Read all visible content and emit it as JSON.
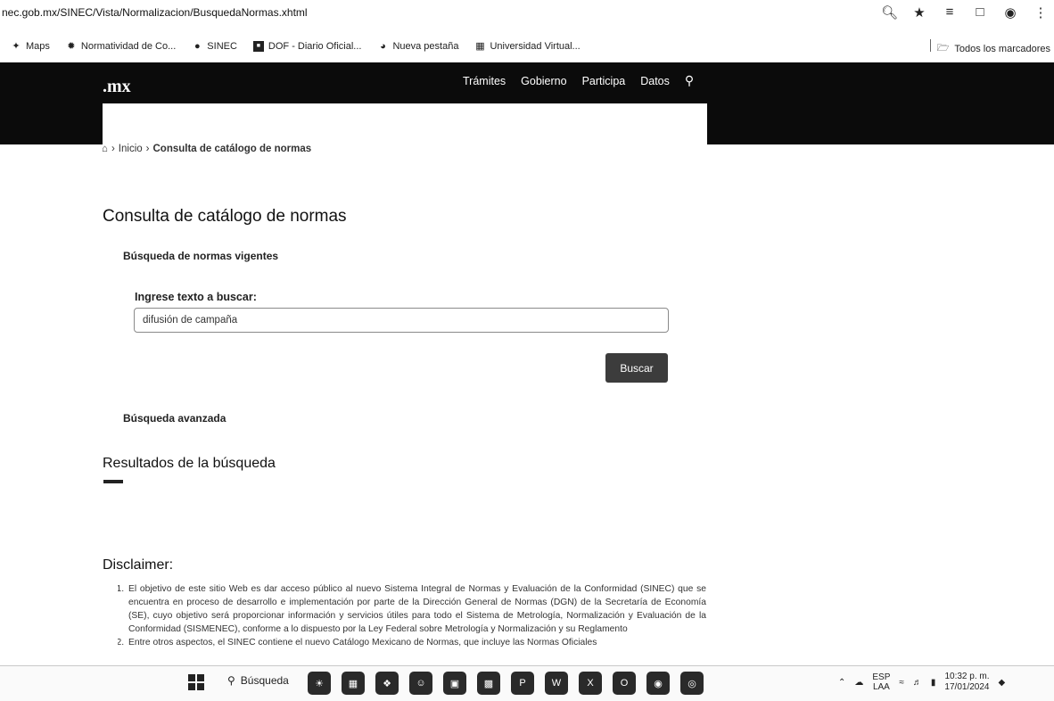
{
  "browser": {
    "url": "nec.gob.mx/SINEC/Vista/Normalizacion/BusquedaNormas.xhtml",
    "bookmarks": [
      {
        "label": "Maps",
        "icon": "maps-icon"
      },
      {
        "label": "Normatividad de Co...",
        "icon": "normatividad-icon"
      },
      {
        "label": "SINEC",
        "icon": "sinec-icon"
      },
      {
        "label": "DOF - Diario Oficial...",
        "icon": "dof-icon"
      },
      {
        "label": "Nueva pestaña",
        "icon": "globe-icon"
      },
      {
        "label": "Universidad Virtual...",
        "icon": "university-icon"
      }
    ],
    "all_bookmarks": "Todos los marcadores"
  },
  "header": {
    "logo": ".mx",
    "nav": [
      "Trámites",
      "Gobierno",
      "Participa",
      "Datos"
    ]
  },
  "breadcrumb": {
    "home": "Inicio",
    "current": "Consulta de catálogo de normas"
  },
  "page": {
    "title": "Consulta de catálogo de normas",
    "section_title": "Búsqueda de normas vigentes",
    "search_label": "Ingrese texto a buscar:",
    "search_value": "difusión de campaña",
    "search_button": "Buscar",
    "advanced_search": "Búsqueda avanzada",
    "results_title": "Resultados de la búsqueda"
  },
  "disclaimer": {
    "title": "Disclaimer:",
    "items": [
      "El objetivo de este sitio Web es dar acceso público al nuevo Sistema Integral de Normas y Evaluación de la Conformidad (SINEC) que se encuentra en proceso de desarrollo e implementación por parte de la Dirección General de Normas (DGN) de la Secretaría de Economía (SE), cuyo objetivo será proporcionar información y servicios útiles para todo el Sistema de Metrología, Normalización y Evaluación de la Conformidad (SISMENEC), conforme a lo dispuesto por la Ley Federal sobre Metrología y Normalización y su Reglamento",
      "Entre otros aspectos, el SINEC contiene el nuevo Catálogo Mexicano de Normas, que incluye las Normas Oficiales"
    ]
  },
  "taskbar": {
    "search": "Búsqueda",
    "lang_top": "ESP",
    "lang_bottom": "LAA",
    "time": "10:32 p. m.",
    "date": "17/01/2024"
  }
}
